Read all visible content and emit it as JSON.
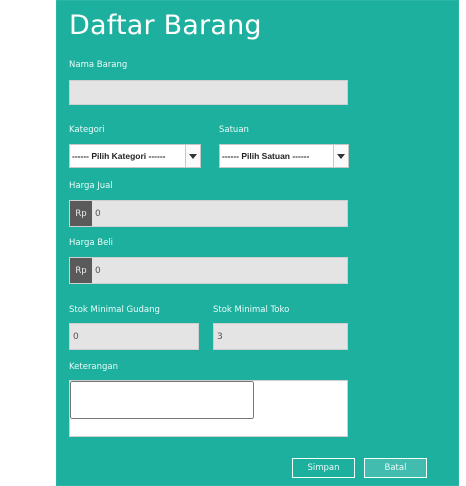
{
  "form": {
    "title": "Daftar Barang",
    "nama_barang": {
      "label": "Nama Barang",
      "value": ""
    },
    "kategori": {
      "label": "Kategori",
      "selected": "------ Pilih Kategori ------"
    },
    "satuan": {
      "label": "Satuan",
      "selected": "------ Pilih Satuan ------"
    },
    "harga_jual": {
      "label": "Harga Jual",
      "prefix": "Rp",
      "value": "0"
    },
    "harga_beli": {
      "label": "Harga Beli",
      "prefix": "Rp",
      "value": "0"
    },
    "stok_minimal_gudang": {
      "label": "Stok Minimal Gudang",
      "value": "0"
    },
    "stok_minimal_toko": {
      "label": "Stok Minimal Toko",
      "value": "3"
    },
    "keterangan": {
      "label": "Keterangan",
      "value": ""
    },
    "buttons": {
      "simpan": "Simpan",
      "batal": "Batal"
    }
  },
  "colors": {
    "panel": "#1eb09f",
    "field": "#e4e4e4",
    "prefix": "#5a5a5a"
  },
  "icons": {
    "dropdown": "chevron-down-icon"
  }
}
